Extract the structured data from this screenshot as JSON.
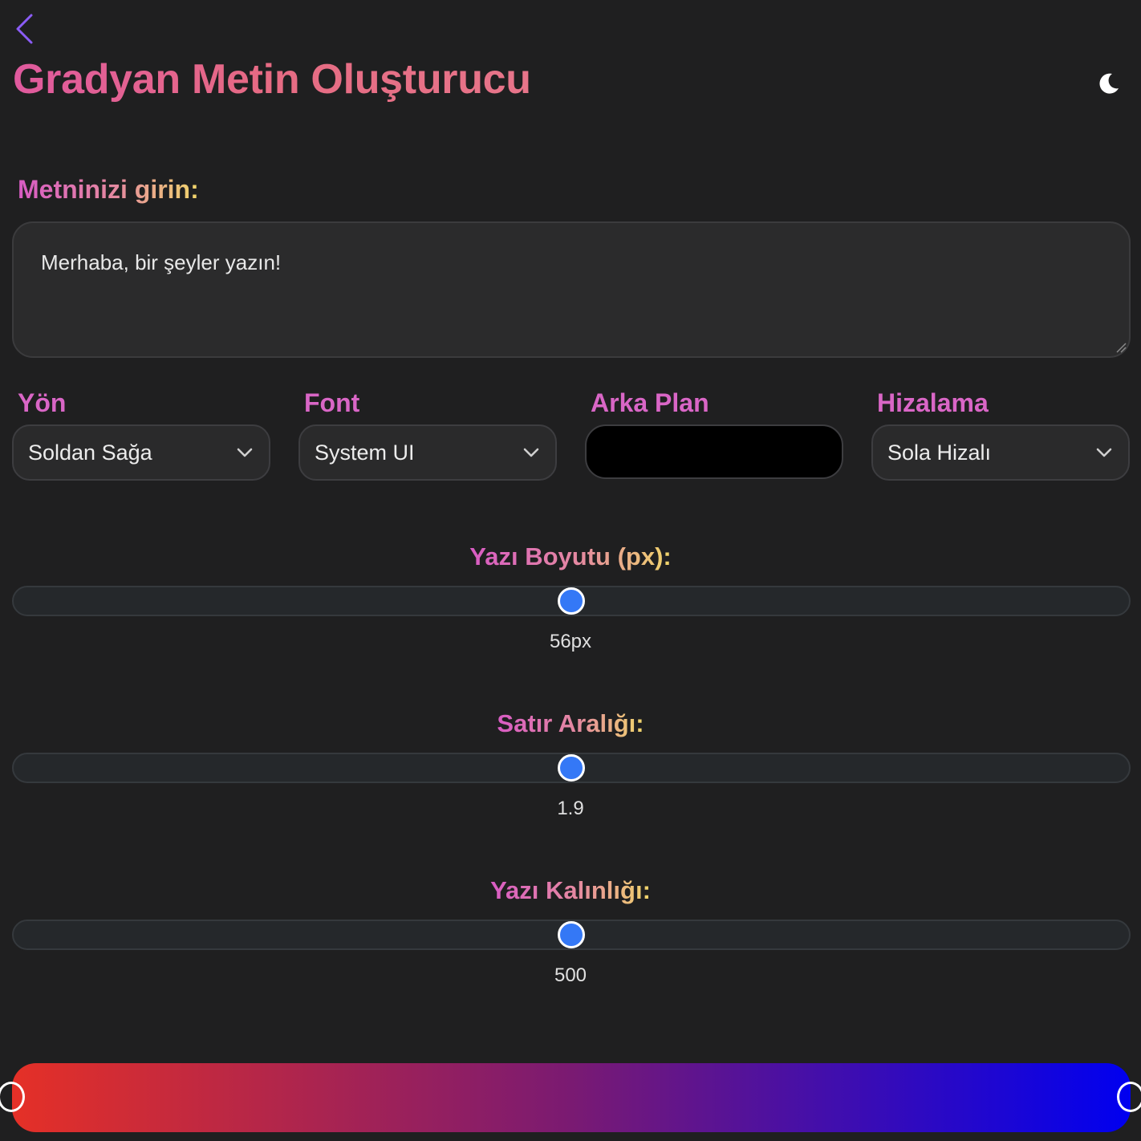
{
  "header": {
    "title": "Gradyan Metin Oluşturucu",
    "back_icon": "chevron-left-icon",
    "theme_icon": "moon-icon"
  },
  "text_input": {
    "label": "Metninizi girin:",
    "value": "Merhaba, bir şeyler yazın!"
  },
  "controls": {
    "direction": {
      "label": "Yön",
      "value": "Soldan Sağa"
    },
    "font": {
      "label": "Font",
      "value": "System UI"
    },
    "background": {
      "label": "Arka Plan",
      "color": "#000000"
    },
    "alignment": {
      "label": "Hizalama",
      "value": "Sola Hizalı"
    }
  },
  "sliders": {
    "font_size": {
      "label": "Yazı Boyutu (px):",
      "value_text": "56px",
      "position": 0.5
    },
    "line_height": {
      "label": "Satır Aralığı:",
      "value_text": "1.9",
      "position": 0.5
    },
    "font_weight": {
      "label": "Yazı Kalınlığı:",
      "value_text": "500",
      "position": 0.5
    }
  },
  "gradient": {
    "start_color": "#e53027",
    "mid_color": "#7a1a72",
    "end_color": "#0000f0",
    "stop_positions": [
      0,
      1
    ]
  },
  "colors": {
    "accent": "#d966c6",
    "thumb": "#3478f6",
    "back_icon": "#8b5cf6"
  }
}
